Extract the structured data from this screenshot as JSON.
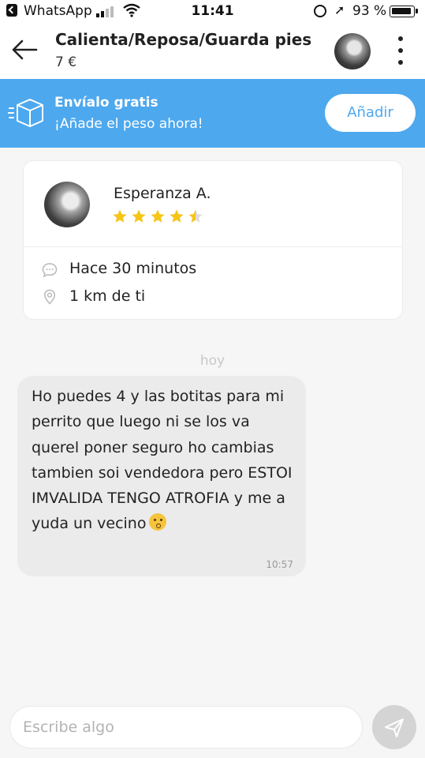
{
  "status_bar": {
    "back_app": "WhatsApp",
    "time": "11:41",
    "battery_percent": "93 %"
  },
  "header": {
    "title": "Calienta/Reposa/Guarda pies",
    "price": "7 €"
  },
  "shipping_banner": {
    "title": "Envíalo gratis",
    "subtitle": "¡Añade el peso ahora!",
    "button_label": "Añadir"
  },
  "seller_card": {
    "name": "Esperanza A.",
    "rating": 4.5,
    "rating_max": 5,
    "last_seen": "Hace 30 minutos",
    "distance": "1 km de ti"
  },
  "chat": {
    "day_label": "hoy",
    "messages": [
      {
        "text": "Ho puedes 4 y las botitas para mi perrito que luego ni se los va querel poner seguro ho cambias tambien soi vendedora pero ESTOI IMVALIDA TENGO ATROFIA y me a yuda un vecino",
        "emoji": "kissing-face",
        "time": "10:57"
      }
    ]
  },
  "composer": {
    "placeholder": "Escribe algo",
    "value": ""
  },
  "colors": {
    "banner": "#4da8ee",
    "star": "#f5c518",
    "bubble": "#ebebeb"
  }
}
